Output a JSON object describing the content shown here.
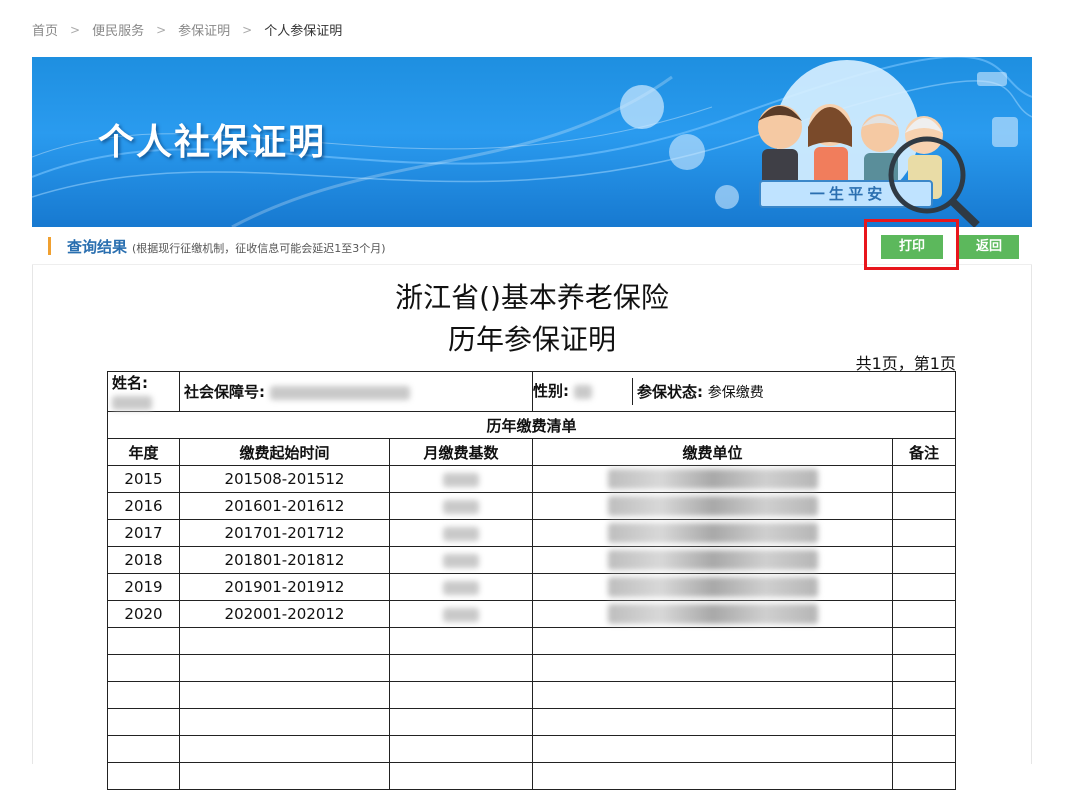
{
  "breadcrumb": {
    "items": [
      {
        "label": "首页"
      },
      {
        "label": "便民服务"
      },
      {
        "label": "参保证明"
      },
      {
        "label": "个人参保证明"
      }
    ],
    "separator": ">"
  },
  "banner": {
    "title": "个人社保证明",
    "slogan": "一 生 平 安"
  },
  "result": {
    "title": "查询结果",
    "note": "(根据现行征缴机制，征收信息可能会延迟1至3个月)"
  },
  "actions": {
    "print_label": "打印",
    "back_label": "返回"
  },
  "document": {
    "title_line1": "浙江省()基本养老保险",
    "title_line2": "历年参保证明",
    "page_info": "共1页，第1页",
    "name_label": "姓名:",
    "ssn_label": "社会保障号:",
    "gender_label": "性别:",
    "status_label": "参保状态:",
    "status_value": "参保缴费",
    "list_title": "历年缴费清单",
    "columns": [
      "年度",
      "缴费起始时间",
      "月缴费基数",
      "缴费单位",
      "备注"
    ],
    "rows": [
      {
        "year": "2015",
        "period": "201508-201512"
      },
      {
        "year": "2016",
        "period": "201601-201612"
      },
      {
        "year": "2017",
        "period": "201701-201712"
      },
      {
        "year": "2018",
        "period": "201801-201812"
      },
      {
        "year": "2019",
        "period": "201901-201912"
      },
      {
        "year": "2020",
        "period": "202001-202012"
      }
    ]
  },
  "colors": {
    "button_green": "#5cb85c",
    "highlight_red": "#e8161c",
    "banner_blue": "#2a9bef",
    "accent_orange": "#f0a030"
  }
}
